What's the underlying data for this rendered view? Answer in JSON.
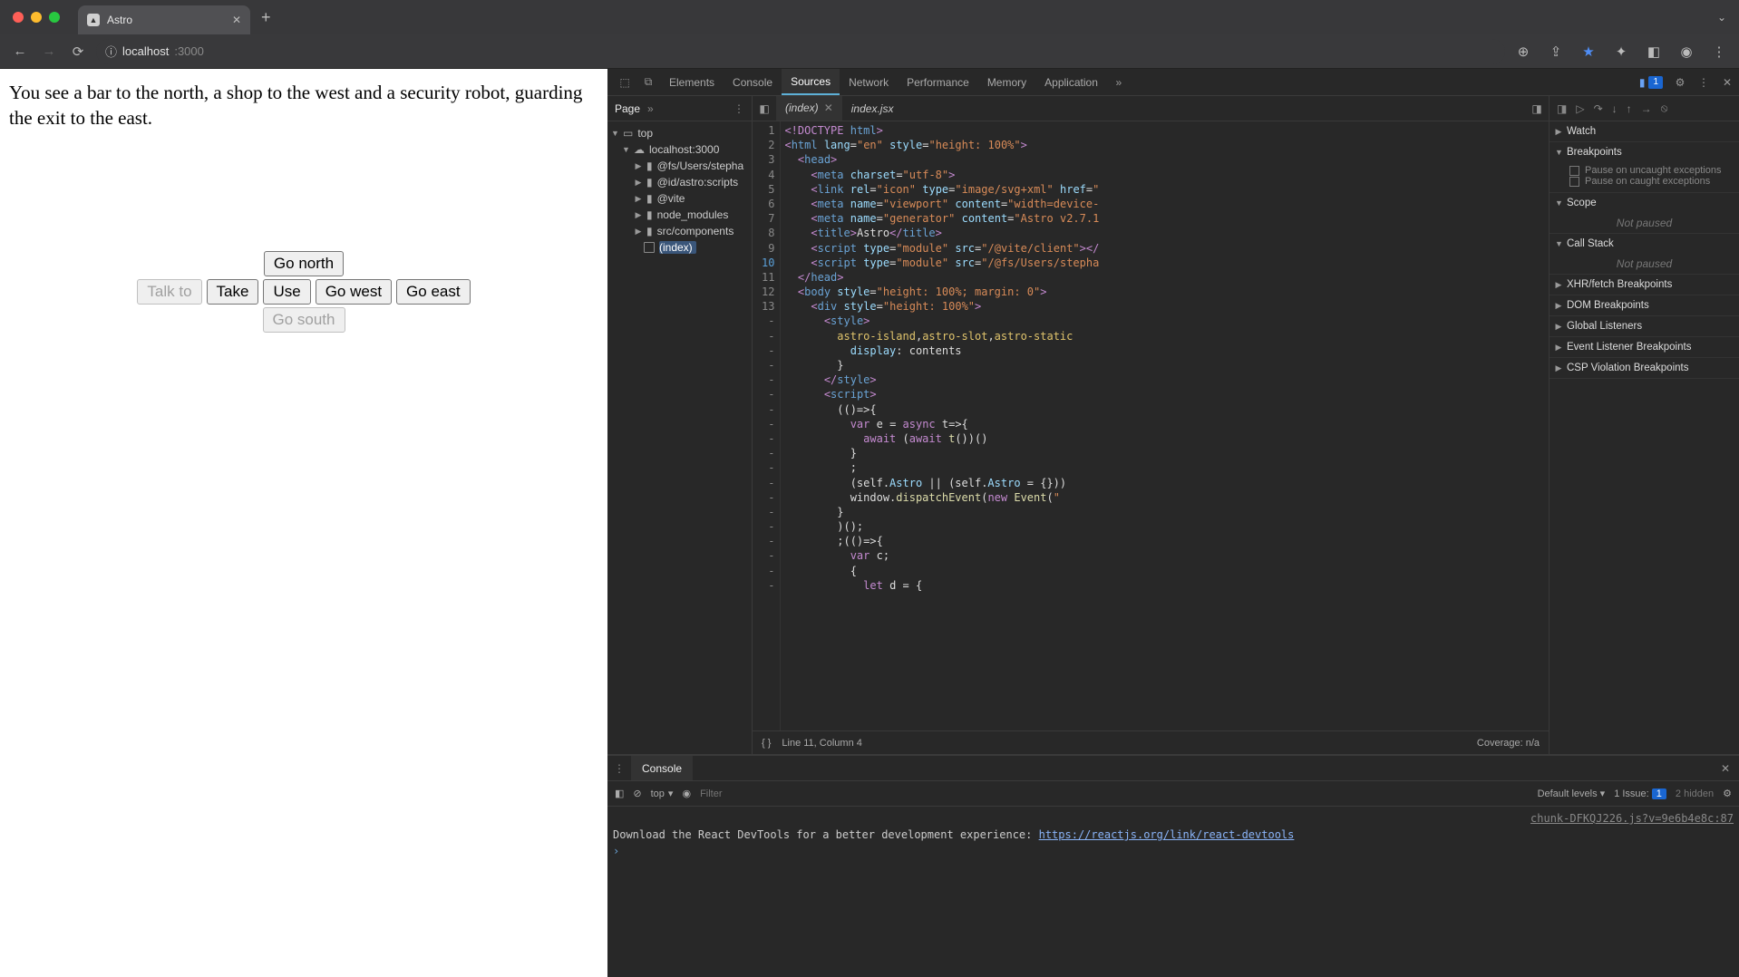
{
  "browser": {
    "tab_title": "Astro",
    "url_host": "localhost",
    "url_port": ":3000"
  },
  "game": {
    "description": "You see a bar to the north, a shop to the west and a security robot, guarding the exit to the east.",
    "buttons": {
      "talk": "Talk to",
      "take": "Take",
      "use": "Use",
      "north": "Go north",
      "west": "Go west",
      "east": "Go east",
      "south": "Go south"
    }
  },
  "devtools": {
    "tabs": {
      "elements": "Elements",
      "console": "Console",
      "sources": "Sources",
      "network": "Network",
      "performance": "Performance",
      "memory": "Memory",
      "application": "Application"
    },
    "issue_count": "1",
    "sources": {
      "page_label": "Page",
      "tree": {
        "top": "top",
        "origin": "localhost:3000",
        "folders": [
          "@fs/Users/stepha",
          "@id/astro:scripts",
          "@vite",
          "node_modules",
          "src/components"
        ],
        "file": "(index)"
      },
      "editor_tabs": {
        "active": "(index)",
        "other": "index.jsx"
      },
      "status_line": "Line 11, Column 4",
      "status_coverage": "Coverage: n/a",
      "code_lines": [
        {
          "n": "1",
          "h": false,
          "html": "<span class='t-k'>&lt;!DOCTYPE</span> <span class='t-tag'>html</span><span class='t-k'>&gt;</span>"
        },
        {
          "n": "2",
          "h": false,
          "html": "<span class='t-k'>&lt;</span><span class='t-tag'>html</span> <span class='t-attr'>lang</span>=<span class='t-str'>\"en\"</span> <span class='t-attr'>style</span>=<span class='t-str'>\"height: 100%\"</span><span class='t-k'>&gt;</span>"
        },
        {
          "n": "3",
          "h": false,
          "html": "  <span class='t-k'>&lt;</span><span class='t-tag'>head</span><span class='t-k'>&gt;</span>"
        },
        {
          "n": "4",
          "h": false,
          "html": "    <span class='t-k'>&lt;</span><span class='t-tag'>meta</span> <span class='t-attr'>charset</span>=<span class='t-str'>\"utf-8\"</span><span class='t-k'>&gt;</span>"
        },
        {
          "n": "5",
          "h": false,
          "html": "    <span class='t-k'>&lt;</span><span class='t-tag'>link</span> <span class='t-attr'>rel</span>=<span class='t-str'>\"icon\"</span> <span class='t-attr'>type</span>=<span class='t-str'>\"image/svg+xml\"</span> <span class='t-attr'>href</span>=<span class='t-str'>\""
        },
        {
          "n": "6",
          "h": false,
          "html": "    <span class='t-k'>&lt;</span><span class='t-tag'>meta</span> <span class='t-attr'>name</span>=<span class='t-str'>\"viewport\"</span> <span class='t-attr'>content</span>=<span class='t-str'>\"width=device-"
        },
        {
          "n": "7",
          "h": false,
          "html": "    <span class='t-k'>&lt;</span><span class='t-tag'>meta</span> <span class='t-attr'>name</span>=<span class='t-str'>\"generator\"</span> <span class='t-attr'>content</span>=<span class='t-str'>\"Astro v2.7.1"
        },
        {
          "n": "8",
          "h": false,
          "html": "    <span class='t-k'>&lt;</span><span class='t-tag'>title</span><span class='t-k'>&gt;</span>Astro<span class='t-k'>&lt;/</span><span class='t-tag'>title</span><span class='t-k'>&gt;</span>"
        },
        {
          "n": "9",
          "h": false,
          "html": "    <span class='t-k'>&lt;</span><span class='t-tag'>script</span> <span class='t-attr'>type</span>=<span class='t-str'>\"module\"</span> <span class='t-attr'>src</span>=<span class='t-str'>\"/@vite/client\"</span><span class='t-k'>&gt;&lt;/"
        },
        {
          "n": "10",
          "h": true,
          "html": "    <span class='t-k'>&lt;</span><span class='t-tag'>script</span> <span class='t-attr'>type</span>=<span class='t-str'>\"module\"</span> <span class='t-attr'>src</span>=<span class='t-str'>\"/@fs/Users/stepha"
        },
        {
          "n": "11",
          "h": false,
          "html": "  <span class='t-k'>&lt;/</span><span class='t-tag'>head</span><span class='t-k'>&gt;</span>"
        },
        {
          "n": "12",
          "h": false,
          "html": "  <span class='t-k'>&lt;</span><span class='t-tag'>body</span> <span class='t-attr'>style</span>=<span class='t-str'>\"height: 100%; margin: 0\"</span><span class='t-k'>&gt;</span>"
        },
        {
          "n": "13",
          "h": false,
          "html": "    <span class='t-k'>&lt;</span><span class='t-tag'>div</span> <span class='t-attr'>style</span>=<span class='t-str'>\"height: 100%\"</span><span class='t-k'>&gt;</span>"
        },
        {
          "n": "-",
          "h": false,
          "html": "      <span class='t-k'>&lt;</span><span class='t-tag'>style</span><span class='t-k'>&gt;</span>"
        },
        {
          "n": "-",
          "h": false,
          "html": "        <span class='t-sel'>astro-island</span>,<span class='t-sel'>astro-slot</span>,<span class='t-sel'>astro-static</span>"
        },
        {
          "n": "-",
          "h": false,
          "html": "          <span class='t-attr'>display</span>: contents"
        },
        {
          "n": "-",
          "h": false,
          "html": "        }"
        },
        {
          "n": "-",
          "h": false,
          "html": "      <span class='t-k'>&lt;/</span><span class='t-tag'>style</span><span class='t-k'>&gt;</span>"
        },
        {
          "n": "-",
          "h": false,
          "html": "      <span class='t-k'>&lt;</span><span class='t-tag'>script</span><span class='t-k'>&gt;</span>"
        },
        {
          "n": "-",
          "h": false,
          "html": "        (()=&gt;{"
        },
        {
          "n": "-",
          "h": false,
          "html": "          <span class='t-k'>var</span> e = <span class='t-k'>async</span> t=&gt;{"
        },
        {
          "n": "-",
          "h": false,
          "html": "            <span class='t-k'>await</span> (<span class='t-k'>await</span> <span class='t-fn'>t</span>())()"
        },
        {
          "n": "-",
          "h": false,
          "html": "          }"
        },
        {
          "n": "-",
          "h": false,
          "html": "          ;"
        },
        {
          "n": "-",
          "h": false,
          "html": "          (self.<span class='t-attr'>Astro</span> || (self.<span class='t-attr'>Astro</span> = {}))"
        },
        {
          "n": "-",
          "h": false,
          "html": "          window.<span class='t-fn'>dispatchEvent</span>(<span class='t-k'>new</span> <span class='t-fn'>Event</span>(<span class='t-str'>\""
        },
        {
          "n": "-",
          "h": false,
          "html": "        }"
        },
        {
          "n": "-",
          "h": false,
          "html": "        )();"
        },
        {
          "n": "-",
          "h": false,
          "html": "        ;(()=&gt;{"
        },
        {
          "n": "-",
          "h": false,
          "html": "          <span class='t-k'>var</span> c;"
        },
        {
          "n": "-",
          "h": false,
          "html": "          {"
        },
        {
          "n": "-",
          "h": false,
          "html": "            <span class='t-k'>let</span> d = {"
        }
      ]
    },
    "debug": {
      "watch": "Watch",
      "breakpoints": "Breakpoints",
      "bp_uncaught": "Pause on uncaught exceptions",
      "bp_caught": "Pause on caught exceptions",
      "scope": "Scope",
      "not_paused": "Not paused",
      "callstack": "Call Stack",
      "xhr": "XHR/fetch Breakpoints",
      "dom": "DOM Breakpoints",
      "global": "Global Listeners",
      "event": "Event Listener Breakpoints",
      "csp": "CSP Violation Breakpoints"
    },
    "console": {
      "tab": "Console",
      "ctx": "top",
      "filter_placeholder": "Filter",
      "levels": "Default levels",
      "issue_label": "1 Issue:",
      "issue_badge": "1",
      "hidden": "2 hidden",
      "src_file": "chunk-DFKQJ226.js?v=9e6b4e8c:87",
      "msg_pre": "Download the React DevTools for a better development experience: ",
      "msg_link": "https://reactjs.org/link/react-devtools"
    }
  }
}
